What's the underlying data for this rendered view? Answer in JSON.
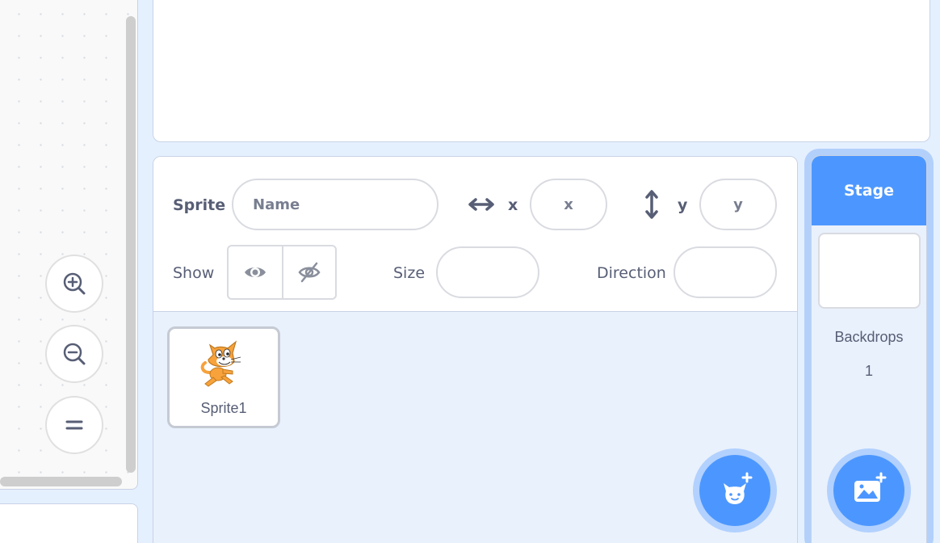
{
  "sprite_info": {
    "sprite_label": "Sprite",
    "name_placeholder": "Name",
    "x_label": "x",
    "x_placeholder": "x",
    "y_label": "y",
    "y_placeholder": "y",
    "show_label": "Show",
    "size_label": "Size",
    "direction_label": "Direction"
  },
  "sprites": [
    {
      "name": "Sprite1"
    }
  ],
  "stage_selector": {
    "header": "Stage",
    "backdrops_label": "Backdrops",
    "backdrops_count": "1"
  },
  "icons": {
    "zoom_in": "zoom-in-icon",
    "zoom_out": "zoom-out-icon",
    "zoom_reset": "zoom-reset-icon",
    "show": "eye-icon",
    "hide": "eye-slash-icon",
    "x_arrow": "horizontal-arrow-icon",
    "y_arrow": "vertical-arrow-icon",
    "add_sprite": "add-sprite-cat-icon",
    "add_backdrop": "add-backdrop-image-icon"
  },
  "colors": {
    "accent": "#4c97ff",
    "text": "#575e75",
    "pane_bg": "#e9f1fc",
    "border": "#c8d2e4"
  }
}
